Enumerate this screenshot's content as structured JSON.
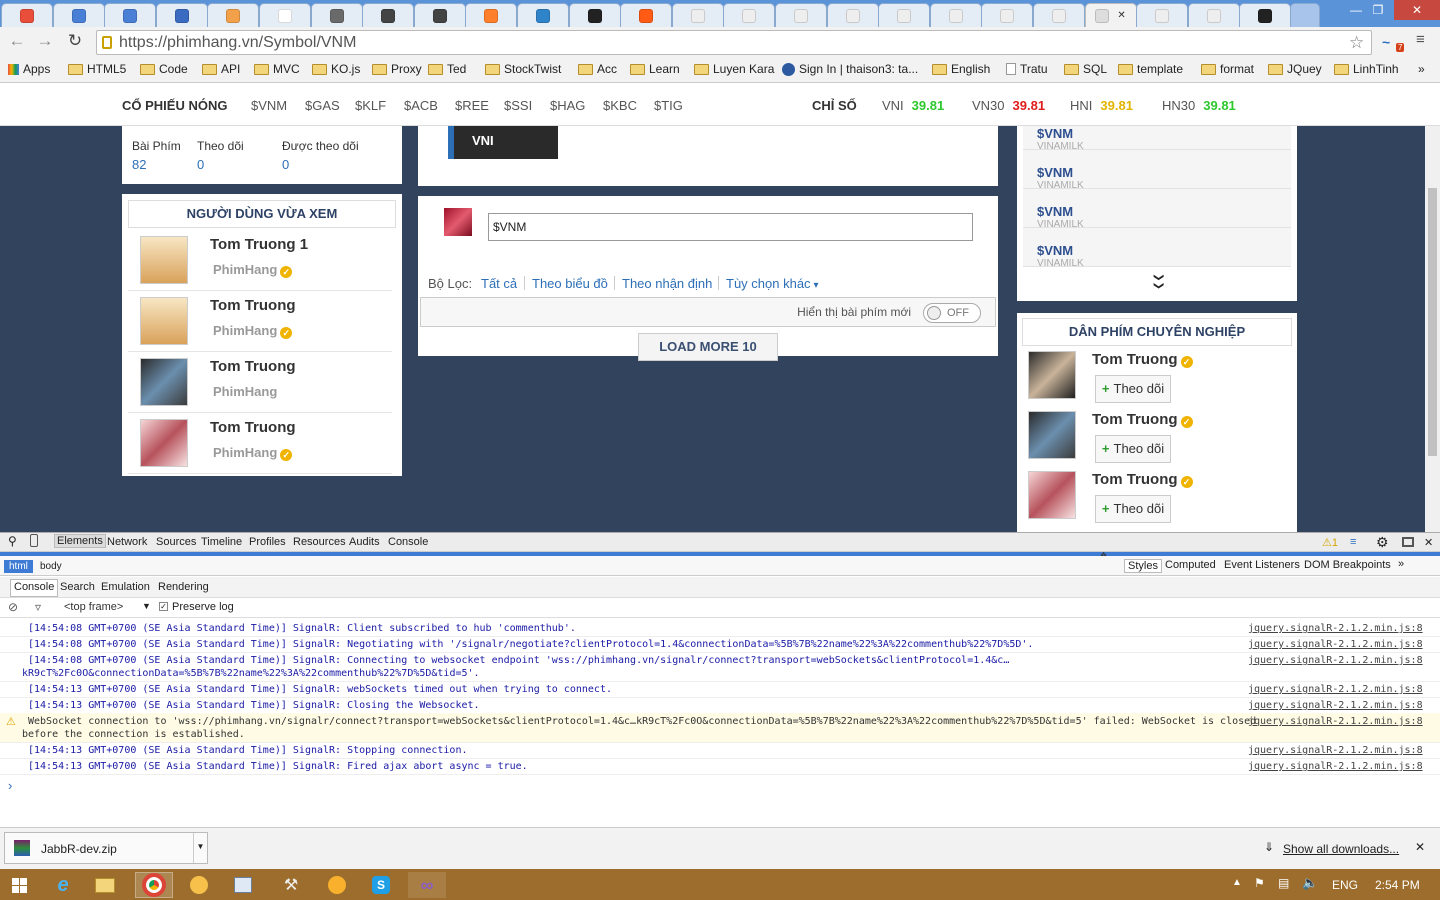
{
  "browser": {
    "url": "https://phimhang.vn/Symbol/VNM",
    "window_controls": {
      "minimize": "—",
      "restore": "❐",
      "close": "✕"
    },
    "bookmarks": [
      "Apps",
      "HTML5",
      "Code",
      "API",
      "MVC",
      "KO.js",
      "Proxy",
      "Ted",
      "StockTwist",
      "Acc",
      "Learn",
      "Luyen Kara",
      "Sign In | thaison3: ta...",
      "English",
      "Tratu",
      "SQL",
      "template",
      "format",
      "JQuey",
      "LinhTinh"
    ],
    "bookmarks_more": "»",
    "tab_favicon_colors": [
      "#e94e3b",
      "#4a7fd6",
      "#4a7fd6",
      "#3b6bc1",
      "#f2a14a",
      "#ffffff",
      "#6a6a6a",
      "#444444",
      "#444444",
      "#ff7f2a",
      "#2f83c9",
      "#222222",
      "#ff5b14",
      "#eeeeee",
      "#eeeeee",
      "#eeeeee",
      "#eeeeee",
      "#eeeeee",
      "#eeeeee",
      "#eeeeee",
      "#eeeeee",
      "#dddddd",
      "#eeeeee",
      "#eeeeee",
      "#222222"
    ],
    "active_tab_close": "✕",
    "extension_badge": "7"
  },
  "hotbar": {
    "hot_label": "CỔ PHIẾU NÓNG",
    "hot_symbols": [
      "$VNM",
      "$GAS",
      "$KLF",
      "$ACB",
      "$REE",
      "$SSI",
      "$HAG",
      "$KBC",
      "$TIG"
    ],
    "index_label": "CHỈ SỐ",
    "indices": [
      {
        "name": "VNI",
        "value": "39.81",
        "color": "#2ec82e"
      },
      {
        "name": "VN30",
        "value": "39.81",
        "color": "#e11b1b"
      },
      {
        "name": "HNI",
        "value": "39.81",
        "color": "#e2b400"
      },
      {
        "name": "HN30",
        "value": "39.81",
        "color": "#2ec82e"
      }
    ]
  },
  "left": {
    "stats": [
      {
        "label": "Bài Phím",
        "value": "82"
      },
      {
        "label": "Theo dõi",
        "value": "0"
      },
      {
        "label": "Được theo dõi",
        "value": "0"
      }
    ],
    "recent_title": "NGƯỜI DÙNG VỪA XEM",
    "recent_users": [
      {
        "name": "Tom Truong 1",
        "source": "PhimHang",
        "verified": true
      },
      {
        "name": "Tom Truong",
        "source": "PhimHang",
        "verified": true
      },
      {
        "name": "Tom Truong",
        "source": "PhimHang",
        "verified": false
      },
      {
        "name": "Tom Truong",
        "source": "PhimHang",
        "verified": true
      }
    ]
  },
  "center": {
    "index_tab": "VNI",
    "post_input_value": "$VNM",
    "filter_label": "Bộ Lọc:",
    "filters": [
      "Tất cả",
      "Theo biểu đồ",
      "Theo nhận định",
      "Tùy chọn khác"
    ],
    "dropdown_caret": "▾",
    "new_posts_label": "Hiển thị bài phím mới",
    "toggle_state": "OFF",
    "load_more": "LOAD MORE 10"
  },
  "right": {
    "symbol_list": [
      {
        "symbol": "$VNM",
        "company": "VINAMILK"
      },
      {
        "symbol": "$VNM",
        "company": "VINAMILK"
      },
      {
        "symbol": "$VNM",
        "company": "VINAMILK"
      },
      {
        "symbol": "$VNM",
        "company": "VINAMILK"
      }
    ],
    "expand_icon": "❯❯",
    "pro_title": "DÂN PHÍM CHUYÊN NGHIỆP",
    "pros": [
      {
        "name": "Tom Truong",
        "verified": true,
        "follow": "Theo dõi"
      },
      {
        "name": "Tom Truong",
        "verified": true,
        "follow": "Theo dõi"
      },
      {
        "name": "Tom Truong",
        "verified": true,
        "follow": "Theo dõi"
      }
    ]
  },
  "devtools": {
    "tabs": [
      "Elements",
      "Network",
      "Sources",
      "Timeline",
      "Profiles",
      "Resources",
      "Audits",
      "Console"
    ],
    "warning_count": "1",
    "crumbs": [
      "html",
      "body"
    ],
    "side_tabs": [
      "Styles",
      "Computed",
      "Event Listeners",
      "DOM Breakpoints"
    ],
    "side_more": "»",
    "drawer_tabs": [
      "Console",
      "Search",
      "Emulation",
      "Rendering"
    ],
    "frame_select": "<top frame>",
    "preserve_log": "Preserve log",
    "prompt": "›",
    "logs": [
      {
        "text": "[14:54:08 GMT+0700 (SE Asia Standard Time)] SignalR: Client subscribed to hub 'commenthub'.",
        "src": "jquery.signalR-2.1.2.min.js:8"
      },
      {
        "text": "[14:54:08 GMT+0700 (SE Asia Standard Time)] SignalR: Negotiating with '/signalr/negotiate?clientProtocol=1.4&connectionData=%5B%7B%22name%22%3A%22commenthub%22%7D%5D'.",
        "src": "jquery.signalR-2.1.2.min.js:8"
      },
      {
        "text": "[14:54:08 GMT+0700 (SE Asia Standard Time)] SignalR: Connecting to websocket endpoint 'wss://phimhang.vn/signalr/connect?transport=webSockets&clientProtocol=1.4&c…",
        "cont": "kR9cT%2Fc0O&connectionData=%5B%7B%22name%22%3A%22commenthub%22%7D%5D&tid=5'.",
        "src": "jquery.signalR-2.1.2.min.js:8"
      },
      {
        "text": "[14:54:13 GMT+0700 (SE Asia Standard Time)] SignalR: webSockets timed out when trying to connect.",
        "src": "jquery.signalR-2.1.2.min.js:8"
      },
      {
        "text": "[14:54:13 GMT+0700 (SE Asia Standard Time)] SignalR: Closing the Websocket.",
        "src": "jquery.signalR-2.1.2.min.js:8"
      },
      {
        "text": "WebSocket connection to 'wss://phimhang.vn/signalr/connect?transport=webSockets&clientProtocol=1.4&c…kR9cT%2Fc0O&connectionData=%5B%7B%22name%22%3A%22commenthub%22%7D%5D&tid=5' failed: WebSocket is closed",
        "cont": "before the connection is established.",
        "src": "jquery.signalR-2.1.2.min.js:8",
        "warning": true
      },
      {
        "text": "[14:54:13 GMT+0700 (SE Asia Standard Time)] SignalR: Stopping connection.",
        "src": "jquery.signalR-2.1.2.min.js:8"
      },
      {
        "text": "[14:54:13 GMT+0700 (SE Asia Standard Time)] SignalR: Fired ajax abort async = true.",
        "src": "jquery.signalR-2.1.2.min.js:8"
      }
    ]
  },
  "downloads": {
    "file": "JabbR-dev.zip",
    "show_all": "Show all downloads...",
    "close": "✕"
  },
  "taskbar": {
    "language": "ENG",
    "time": "2:54 PM"
  }
}
